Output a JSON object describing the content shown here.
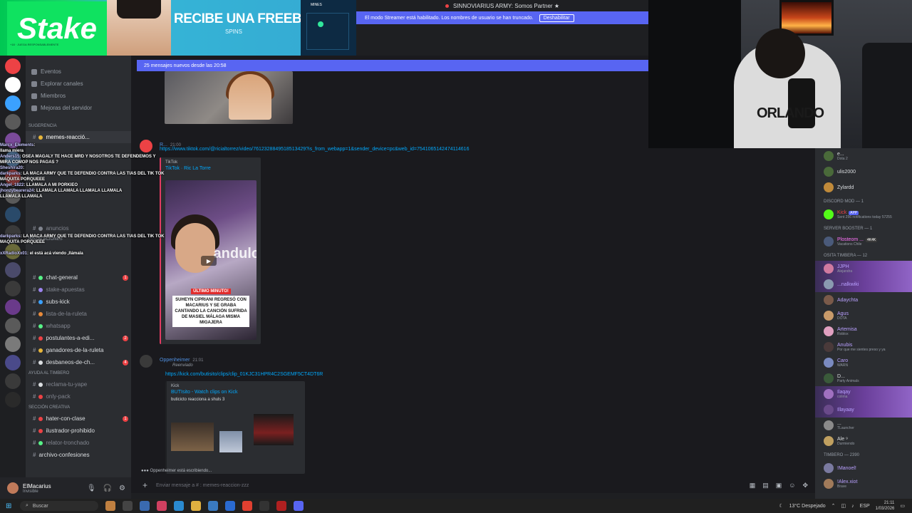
{
  "stream_header": {
    "title": "SINNOVIARIUS ARMY: Somos Partner ★"
  },
  "streamer_banner": {
    "text": "El modo Streamer está habilitado. Los nombres de usuario se han truncado.",
    "button": "Deshabilitar"
  },
  "ad": {
    "logo": "Stake",
    "headline": "RECIBE UNA FREEBET",
    "sub": "SPINS",
    "game_title": "MINES"
  },
  "sidebar": {
    "top_items": [
      "Eventos",
      "Explorar canales",
      "Miembros",
      "Mejoras del servidor"
    ],
    "suggestion_label": "Sugerencia",
    "channels": [
      {
        "name": "memes-reacció...",
        "emoji_color": "#e8b63a",
        "muted": false
      },
      {
        "name": "anuncios",
        "emoji_color": "#80848e",
        "muted": true
      },
      {
        "name": "chat-general",
        "emoji_color": "#57f287",
        "badge": "1"
      },
      {
        "name": "stake-apuestas",
        "emoji_color": "#9c84ef",
        "muted": true
      },
      {
        "name": "subs-kick",
        "emoji_color": "#3ba1ff"
      },
      {
        "name": "lista-de-la-ruleta",
        "emoji_color": "#e88a3a",
        "muted": true
      },
      {
        "name": "whatsapp",
        "emoji_color": "#57f287",
        "muted": true
      },
      {
        "name": "postulantes-a-edi...",
        "emoji_color": "#ed4245",
        "badge": "2"
      },
      {
        "name": "ganadores-de-la-ruleta",
        "emoji_color": "#e8b63a"
      },
      {
        "name": "desbaneos-de-ch...",
        "emoji_color": "#dbdee1",
        "badge": "4"
      }
    ],
    "categories": {
      "instalaciones": "INSTALACIONES",
      "ayuda": "AYUDA AL TIMBERO",
      "creativa": "SECCIÓN CREATIVA"
    },
    "help_channels": [
      {
        "name": "reclama-tu-yape",
        "emoji_color": "#dbdee1"
      },
      {
        "name": "only-pack",
        "emoji_color": "#ed4245"
      }
    ],
    "creative_channels": [
      {
        "name": "hater-con-clase",
        "emoji_color": "#ed4245",
        "badge": "1"
      },
      {
        "name": "ilustrador-prohibido",
        "emoji_color": "#ed4245"
      },
      {
        "name": "relator-tronchado",
        "emoji_color": "#57f287"
      },
      {
        "name": "archivo-confesiones",
        "emoji_color": "#dbdee1"
      }
    ]
  },
  "user_panel": {
    "name": "ElMacarius",
    "status": "Invisible"
  },
  "chat": {
    "new_messages": "25 mensajes nuevos desde las 20:58",
    "msg1": {
      "author": "R...",
      "time": "21:00",
      "link": "https://www.tiktok.com/@ricialtorrez/video/7612328849518513429?is_from_webapp=1&sender_device=pc&web_id=7541065142474114616",
      "embed_provider": "TikTok",
      "embed_title": "TikTok · Ric La Torre",
      "video_tag": "ÚLTIMO MINUTO!",
      "video_caption": "SUHEYN CIPRIANI REGRESÓ CON MACARIUS Y SE GRABA CANTANDO LA CANCIÓN SUFRIDA DE MASIEL MÁLAGA MISMA MIGAJERA",
      "video_brand": "andulc"
    },
    "msg2": {
      "author": "Oppenheimer",
      "time": "21:01",
      "forwarded": "Reenviado",
      "link": "https://kick.com/butisito/clips/clip_01KJC31HPR4C2SGEMF5CT4DT6R",
      "embed_provider": "Kick",
      "embed_title": "BUTIsito - Watch clips on Kick",
      "embed_desc": "buticicto reacciona a shuls 3"
    },
    "typing": "Oppenheimer está escribiendo...",
    "composer_placeholder": "Enviar mensaje a # : memes-reaccion-zzz"
  },
  "members": {
    "top_sub": "Dota 2",
    "top_rows": [
      {
        "name": "ulis2000",
        "color": "#dbdee1",
        "av": "#4a6a3a"
      },
      {
        "name": "Zylardd",
        "color": "#dbdee1",
        "av": "#c08a3a"
      }
    ],
    "discord_mod_label": "DISCORD MOD — 1",
    "mod_name": "Kick",
    "mod_tag": "APP",
    "mod_sub": "Sent 256 notifications today 57255",
    "booster_label": "SERVER BOOSTER — 1",
    "booster_name": "Plosteom ...",
    "booster_tag": "4K4K",
    "booster_sub": "Vacations Chile",
    "timbera_label": "OSITA TIMBERA — 12",
    "timbera_rows": [
      {
        "name": "JJPH",
        "sub": "Alejandra",
        "color": "#b9a0ff",
        "av": "#d07aa0",
        "hl": true
      },
      {
        "name": "...nalkwiki",
        "sub": "",
        "color": "#b9a0ff",
        "av": "#8a9ab0",
        "hl": true
      },
      {
        "name": "Adaychta",
        "sub": "",
        "color": "#b9a0ff",
        "av": "#7a5a4a",
        "hl": false
      },
      {
        "name": "Agus",
        "sub": "DOTA",
        "color": "#b9a0ff",
        "av": "#c89a6a",
        "hl": false
      },
      {
        "name": "Artemisa",
        "sub": "Roblox",
        "color": "#b9a0ff",
        "av": "#e0a0c0",
        "hl": false
      },
      {
        "name": "Anubis",
        "sub": "Por que me sientes preso y ya",
        "color": "#b9a0ff",
        "av": "#4a3a3a",
        "hl": false
      },
      {
        "name": "Caro",
        "sub": "WARN",
        "color": "#b9a0ff",
        "av": "#7a8ac0",
        "hl": false
      },
      {
        "name": "D...",
        "sub": "Party Animals",
        "color": "#dbdee1",
        "av": "#3a5a3a",
        "hl": false
      },
      {
        "name": "Ilaqay",
        "sub": "colima",
        "color": "#b9a0ff",
        "av": "#a070c0",
        "hl": true
      },
      {
        "name": "Illayaay",
        "sub": "",
        "color": "#b9a0ff",
        "av": "#6a4a8a",
        "hl": true
      },
      {
        "name": "...",
        "sub": "TLauncher",
        "color": "#dbdee1",
        "av": "#8a8a8a",
        "hl": false
      },
      {
        "name": "Ale ⁹",
        "sub": "Durmiendo",
        "color": "#dbdee1",
        "av": "#c0a060",
        "hl": false
      }
    ],
    "timbero_label": "TIMBERO — 2390",
    "timbero_rows": [
      {
        "name": "!Manoel!",
        "sub": "",
        "color": "#b9a0ff",
        "av": "#7a7aa0"
      },
      {
        "name": "!Alex.xiot",
        "sub": "Brave",
        "color": "#b9a0ff",
        "av": "#a07a5a"
      }
    ]
  },
  "overlay_chat": [
    {
      "user": "Marcx_Elements",
      "text": ":"
    },
    {
      "user": "",
      "text": "llama miera"
    },
    {
      "user": "Anders15",
      "text": ": OSEA MAGALY TE HACE MRD Y NOSOTROS TE DEFENDEMOS Y"
    },
    {
      "user": "",
      "text": "MIRA COMOP NOS PAGAS ?"
    },
    {
      "user": "Sheshira20",
      "text": ":"
    },
    {
      "user": "darkparks",
      "text": ": LA MACA ARMY QUE TE DEFENDIO CONTRA LAS TIAS DEL TIK TOK"
    },
    {
      "user": "",
      "text": "MAQUITA PORQUEEE"
    },
    {
      "user": "Angel_1822",
      "text": ": LLAMALA A MI PORKIEO"
    },
    {
      "user": "jhonzybearera24",
      "text": ": LLAMALA  LLAMALA  LLAMALA  LLAMALA"
    },
    {
      "user": "",
      "text": "LLAMALA  LLAMALA"
    },
    {
      "user": "",
      "text": ""
    },
    {
      "user": "",
      "text": ""
    },
    {
      "user": "",
      "text": ""
    },
    {
      "user": "",
      "text": ""
    },
    {
      "user": "",
      "text": ""
    },
    {
      "user": "",
      "text": ""
    },
    {
      "user": "darkparks",
      "text": ": LA MACA ARMY QUE TE DEFENDIO CONTRA LAS TIAS DEL TIK TOK"
    },
    {
      "user": "",
      "text": "MAQUITA PORQUEEE"
    },
    {
      "user": "",
      "text": ""
    },
    {
      "user": "xXRadioXx01",
      "text": ": el está acá viendo ,llámala"
    }
  ],
  "webcam": {
    "shirt_text": "ORLANDO"
  },
  "taskbar": {
    "search": "Buscar",
    "weather": "13°C Despejado",
    "lang": "ESP",
    "time": "21:11",
    "date": "1/03/2026"
  }
}
